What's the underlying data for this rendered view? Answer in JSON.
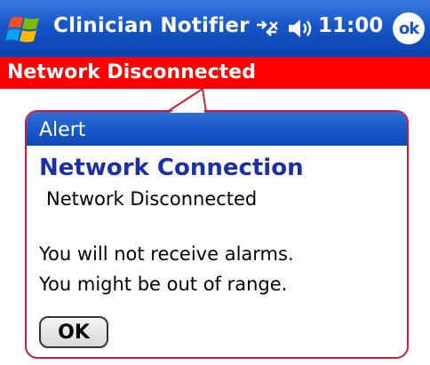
{
  "titlebar": {
    "app_title": "Clinician Notifier",
    "clock": "11:00",
    "ok_label": "ok",
    "start_icon": "windows-flag-icon",
    "connectivity_icon": "connectivity-icon",
    "volume_icon": "volume-icon"
  },
  "status_banner": {
    "text": "Network Disconnected",
    "color": "#ff0000"
  },
  "alert": {
    "header": "Alert",
    "heading": "Network Connection",
    "subtitle": "Network Disconnected",
    "line1": "You will not receive alarms.",
    "line2": "You might be out of range.",
    "ok_button_label": "OK",
    "border_color": "#cc1a3a",
    "heading_color": "#1a2fa8"
  },
  "colors": {
    "titlebar_blue": "#1656c8",
    "banner_red": "#ff0000"
  }
}
